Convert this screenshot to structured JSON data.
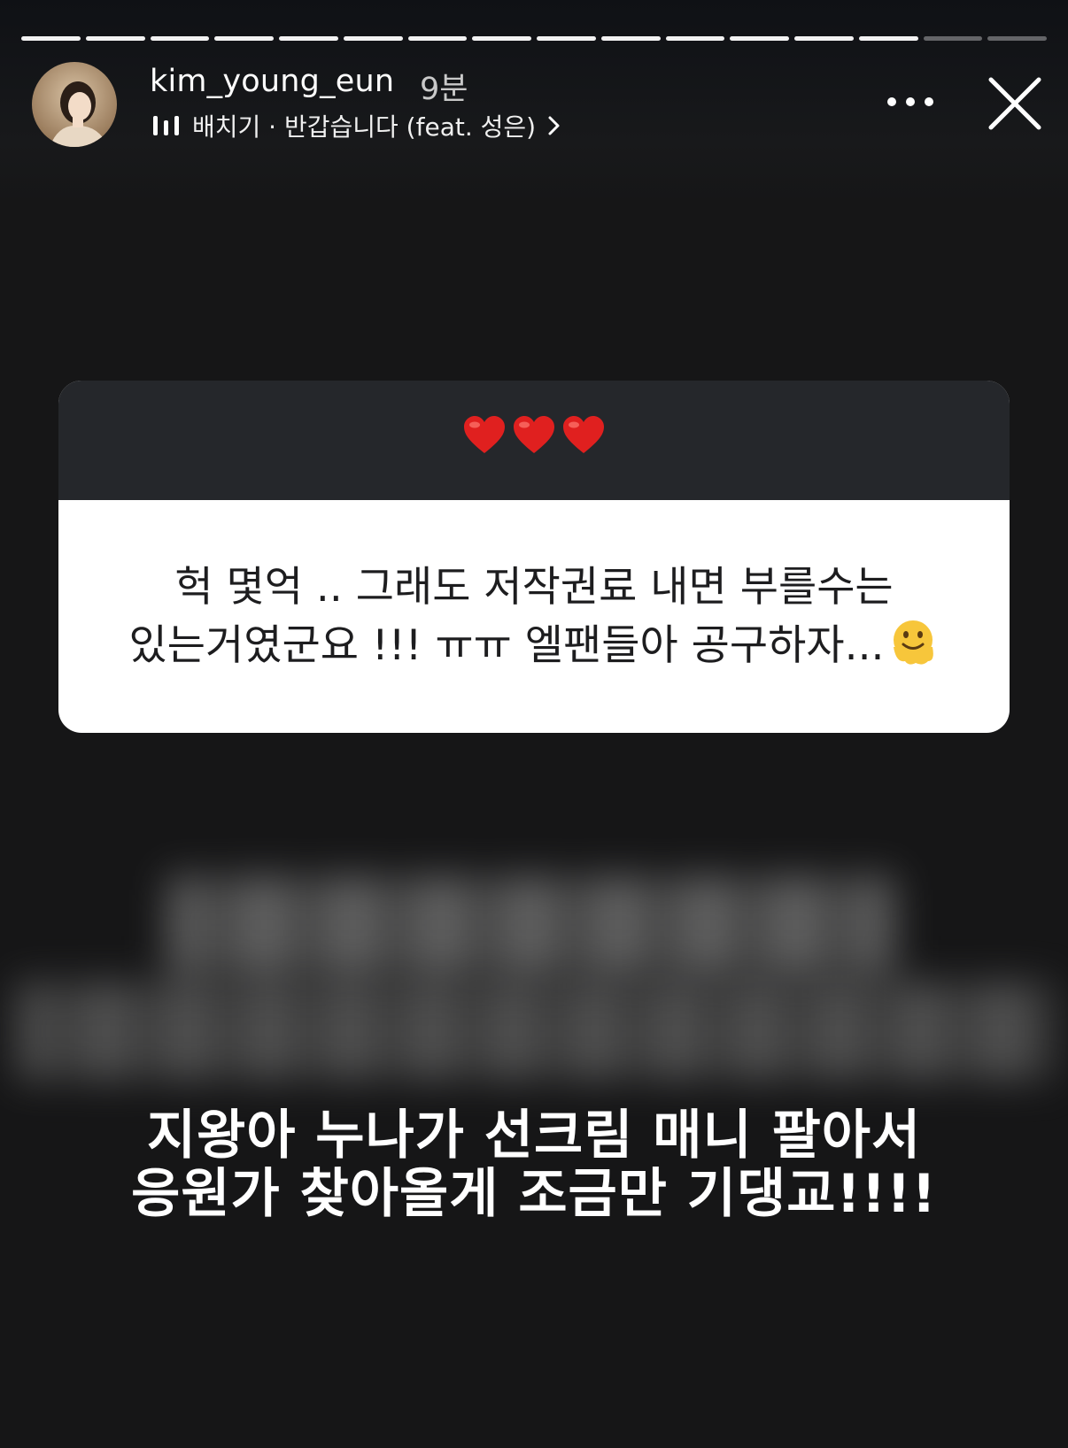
{
  "story": {
    "segments_total": 16,
    "segments_completed": 14
  },
  "header": {
    "username": "kim_young_eun",
    "time": "9분",
    "music": "배치기 · 반갑습니다 (feat. 성은)",
    "icons": {
      "music": "music-bars-icon",
      "chevron": "chevron-right-icon",
      "more": "more-horizontal-icon",
      "close": "close-icon"
    }
  },
  "question_box": {
    "question_emoji": "heart-icon x3",
    "heart_color": "#e0201f",
    "answer_line1": "헉 몇억 .. 그래도 저작권료 내면 부를수는",
    "answer_line2": "있는거였군요 !!! ㅠㅠ 엘팬들아 공구하자...",
    "answer_emoji": "melting-face-icon"
  },
  "caption": {
    "line1": "지왕아 누나가 선크림 매니 팔아서",
    "line2": "응원가 찾아올게 조금만 기댕교!!!!"
  }
}
